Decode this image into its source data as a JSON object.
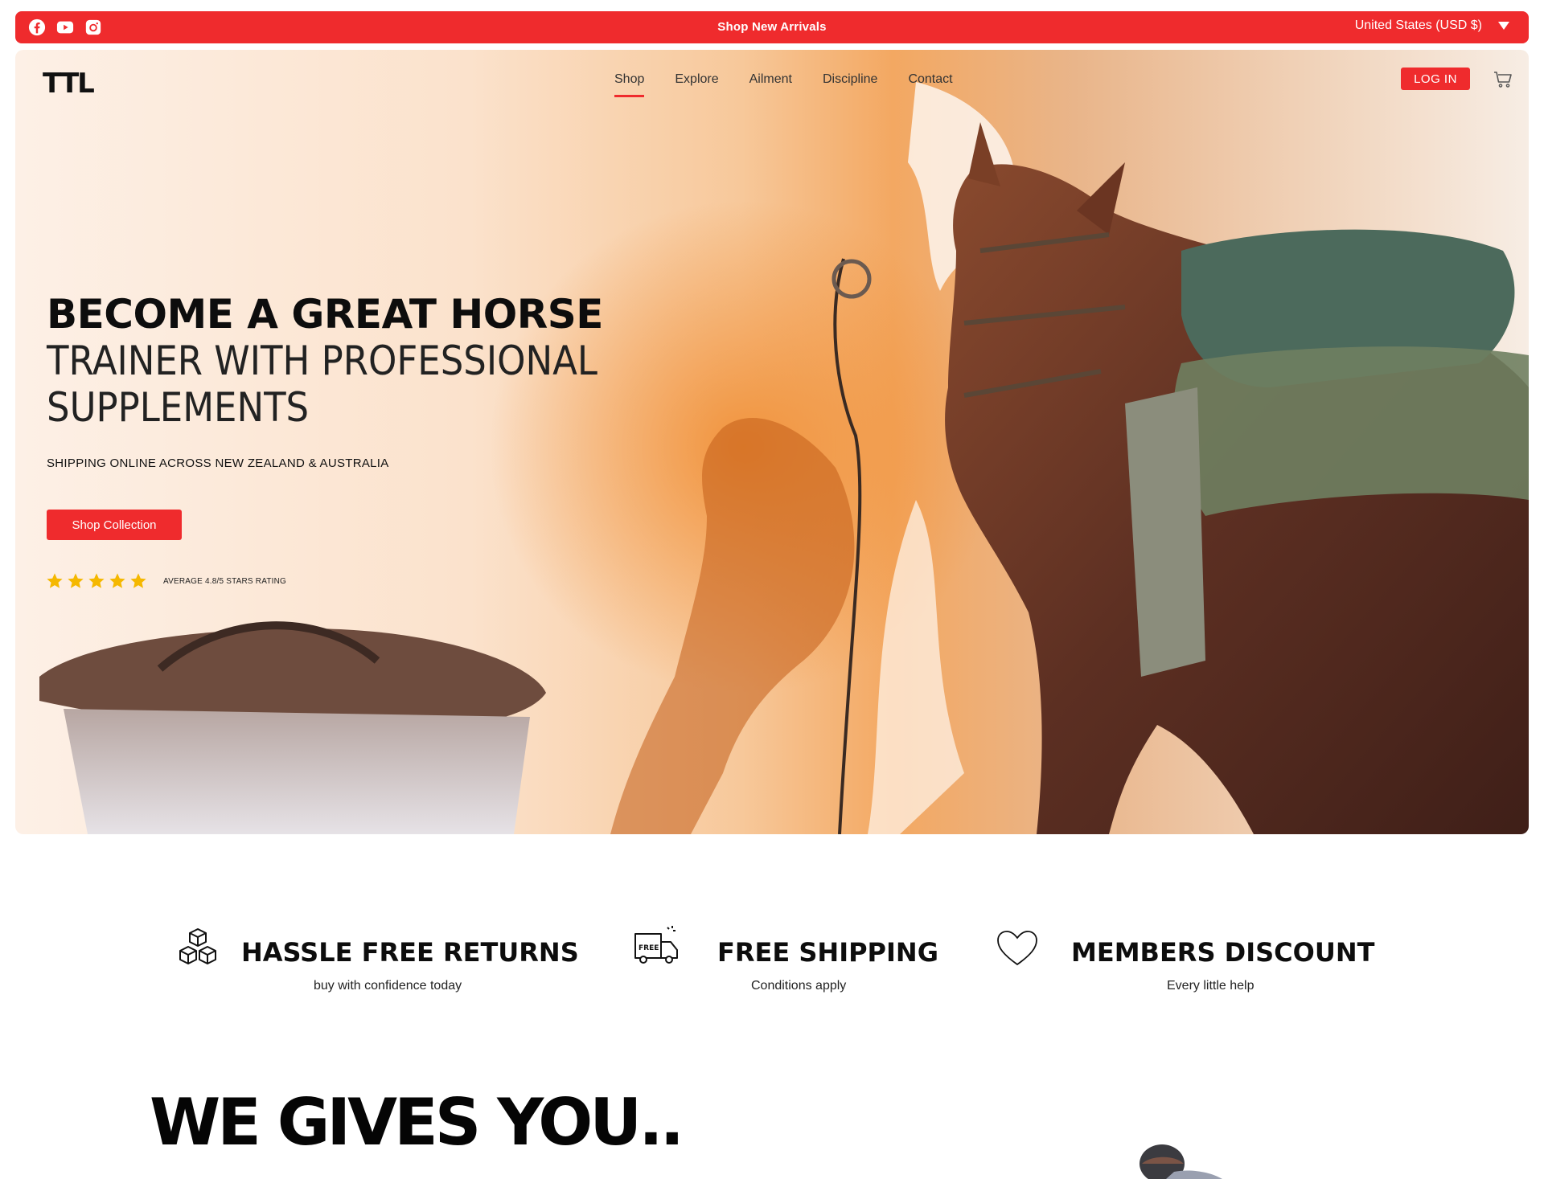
{
  "topbar": {
    "promo": "Shop New Arrivals",
    "region": "United States (USD $)",
    "socials": [
      "facebook-icon",
      "youtube-icon",
      "instagram-icon"
    ],
    "color": "#ef2b2d"
  },
  "nav": {
    "logo": "TTL",
    "items": [
      {
        "label": "Shop",
        "active": true
      },
      {
        "label": "Explore",
        "active": false
      },
      {
        "label": "Ailment",
        "active": false
      },
      {
        "label": "Discipline",
        "active": false
      },
      {
        "label": "Contact",
        "active": false
      }
    ],
    "login": "LOG IN"
  },
  "hero": {
    "headline_bold": "BECOME A GREAT HORSE",
    "headline_line2": "TRAINER WITH PROFESSIONAL",
    "headline_line3": "SUPPLEMENTS",
    "subtitle": "SHIPPING ONLINE ACROSS NEW ZEALAND & AUSTRALIA",
    "cta": "Shop Collection",
    "rating_stars": 5,
    "rating_text": "AVERAGE 4.8/5 STARS RATING"
  },
  "features": [
    {
      "icon": "boxes-icon",
      "title": "HASSLE FREE RETURNS",
      "subtitle": "buy with confidence today"
    },
    {
      "icon": "free-shipping-truck-icon",
      "title": "FREE SHIPPING",
      "subtitle": "Conditions apply"
    },
    {
      "icon": "heart-icon",
      "title": "MEMBERS DISCOUNT",
      "subtitle": "Every little help"
    }
  ],
  "section": {
    "title": "WE GIVES YOU.."
  },
  "colors": {
    "accent": "#ef2b2d",
    "star": "#f5b800",
    "text": "#111111"
  }
}
